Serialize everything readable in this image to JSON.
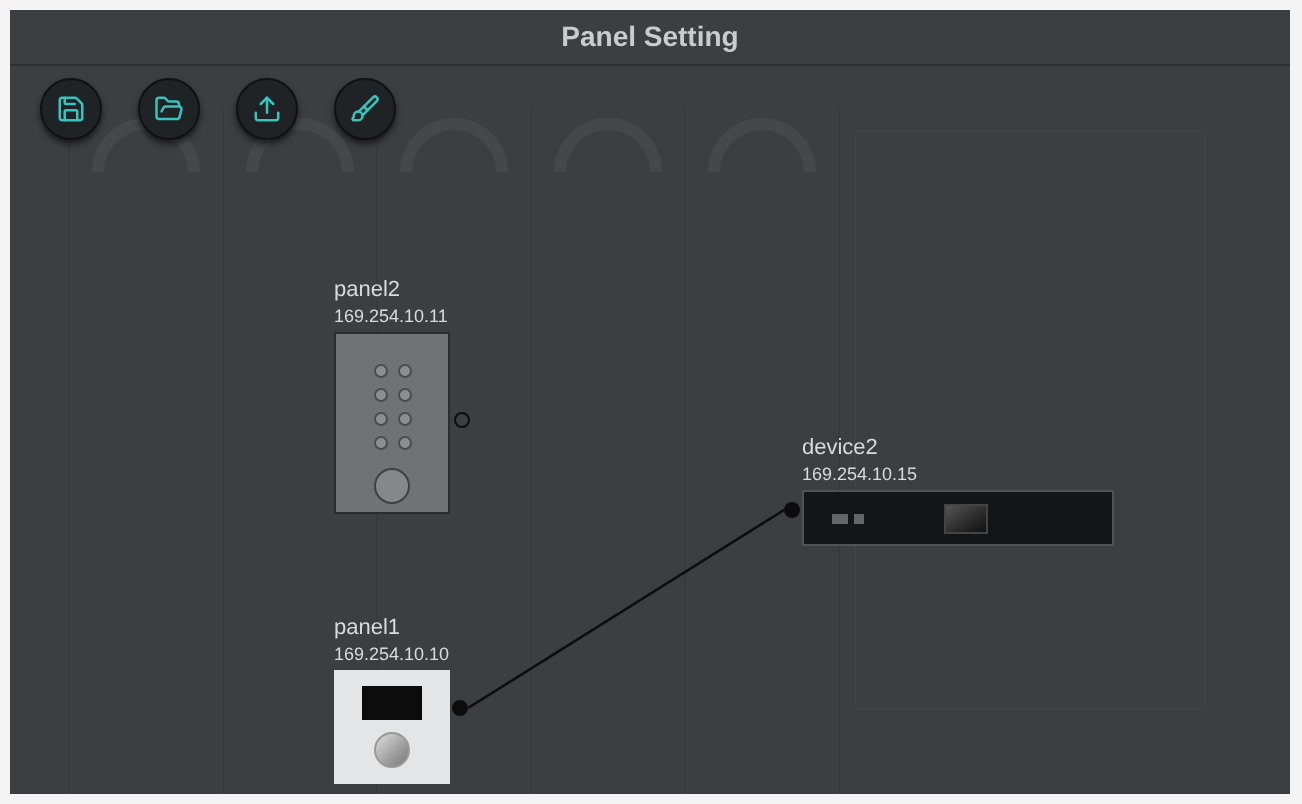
{
  "window": {
    "title": "Panel Setting"
  },
  "toolbar": [
    {
      "kind": "save"
    },
    {
      "kind": "open"
    },
    {
      "kind": "upload"
    },
    {
      "kind": "clear"
    }
  ],
  "nodes": [
    {
      "name": "panel2",
      "ip": "169.254.10.11",
      "kind": "keypad",
      "connected": false
    },
    {
      "name": "device2",
      "ip": "169.254.10.15",
      "kind": "rack",
      "connected": true
    },
    {
      "name": "panel1",
      "ip": "169.254.10.10",
      "kind": "knob",
      "connected": true
    }
  ]
}
